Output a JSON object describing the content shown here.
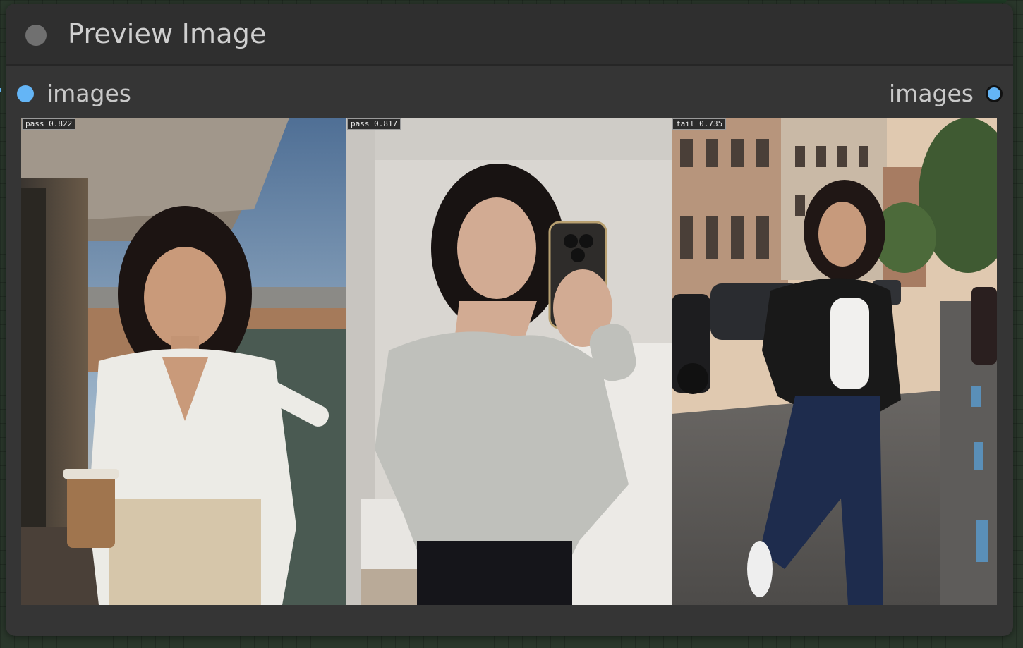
{
  "node": {
    "title": "Preview Image",
    "input_label": "images",
    "output_label": "images"
  },
  "images": [
    {
      "badge": "pass 0.822",
      "scene": "balcony-selfie-with-iced-coffee"
    },
    {
      "badge": "pass 0.817",
      "scene": "mirror-selfie-grey-sweater"
    },
    {
      "badge": "fail 0.735",
      "scene": "street-photo-leather-jacket"
    }
  ],
  "colors": {
    "node_bg": "#353535",
    "header_bg": "#2f2f2f",
    "slot_blue": "#64b5f6",
    "text": "#cfcfcf"
  }
}
